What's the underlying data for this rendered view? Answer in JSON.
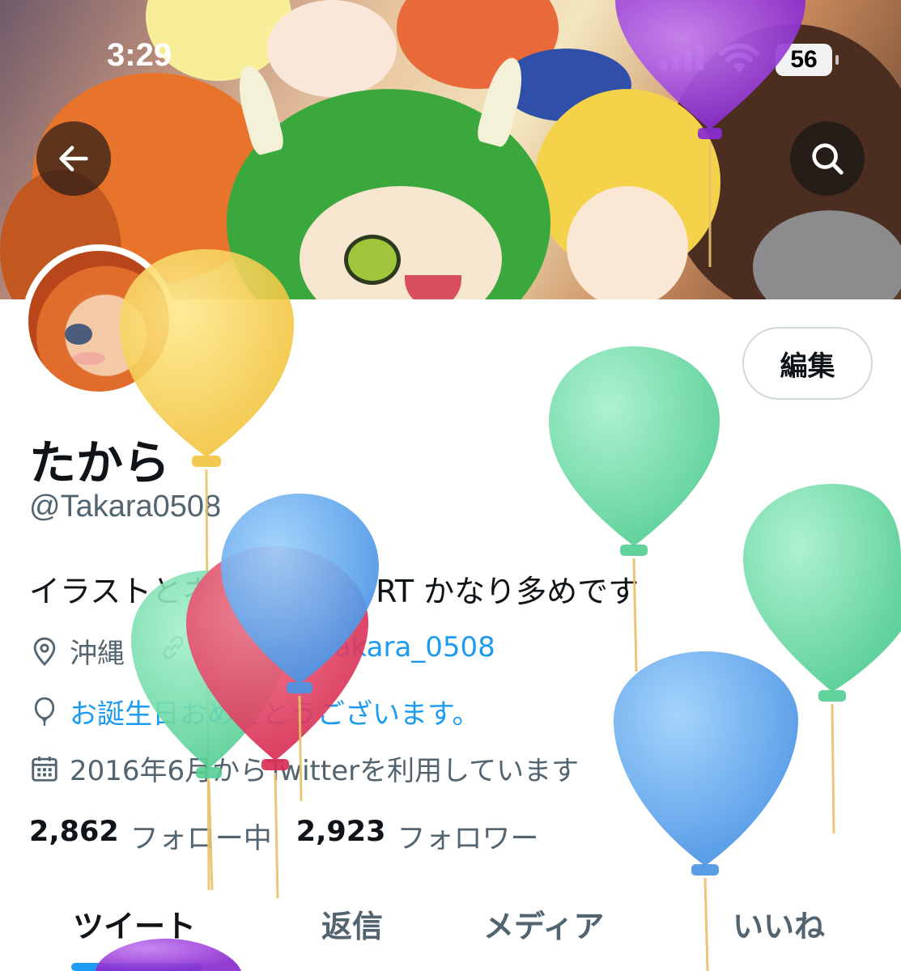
{
  "status_bar": {
    "time": "3:29",
    "battery": "56"
  },
  "header": {
    "back_icon": "arrow-left-icon",
    "search_icon": "search-icon"
  },
  "profile": {
    "edit_label": "編集",
    "display_name": "たから",
    "handle": "@Takara0508",
    "bio": "イラストとネットミーム RT かなり多めです",
    "location": "沖縄",
    "link": "pixiv.me/takara_0508",
    "birthday": "お誕生日おめでとうございます。",
    "joined": "2016年6月からTwitterを利用しています",
    "following_count": "2,862",
    "following_label": "フォロー中",
    "followers_count": "2,923",
    "followers_label": "フォロワー"
  },
  "tabs": [
    {
      "label": "ツイート",
      "active": true
    },
    {
      "label": "返信",
      "active": false
    },
    {
      "label": "メディア",
      "active": false
    },
    {
      "label": "いいね",
      "active": false
    }
  ],
  "colors": {
    "accent": "#1d9bf0",
    "text": "#0f1419",
    "secondary_text": "#536471",
    "balloon_yellow": "#f7c948",
    "balloon_green": "#67d9a0",
    "balloon_blue": "#5aa7ee",
    "balloon_red": "#e0405e",
    "balloon_purple": "#9b3fd8"
  }
}
